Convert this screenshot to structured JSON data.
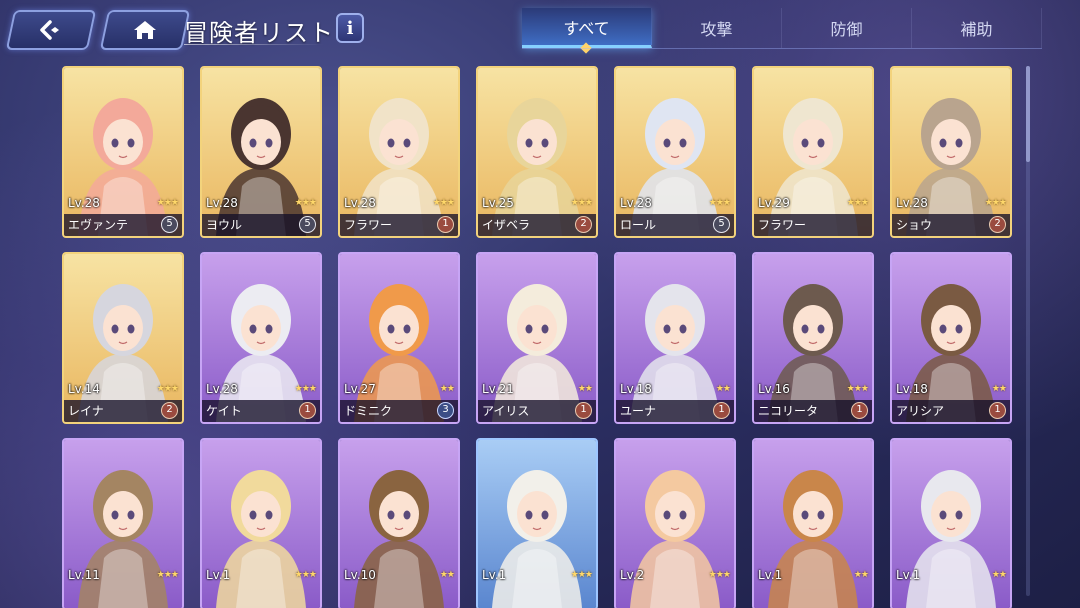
{
  "header": {
    "title": "冒険者リスト",
    "info_label": "i",
    "back_icon": "back-arrow-icon",
    "home_icon": "home-icon"
  },
  "tabs": [
    {
      "label": "すべて",
      "active": true
    },
    {
      "label": "攻撃",
      "active": false
    },
    {
      "label": "防御",
      "active": false
    },
    {
      "label": "補助",
      "active": false
    }
  ],
  "colors": {
    "gold_frame": "#f3d37c",
    "purple_frame": "#c7a5f5",
    "active_tab": "#3f6dc4"
  },
  "cards": [
    {
      "level": "Lv.28",
      "name": "エヴァンテ",
      "badge": "5",
      "stars": "★★★",
      "frame": "gold"
    },
    {
      "level": "Lv.28",
      "name": "ヨウル",
      "badge": "5",
      "stars": "★★★",
      "frame": "gold"
    },
    {
      "level": "Lv.28",
      "name": "フラワー",
      "badge": "1",
      "stars": "★★★",
      "frame": "gold"
    },
    {
      "level": "Lv.25",
      "name": "イザベラ",
      "badge": "2",
      "stars": "★★★",
      "frame": "gold"
    },
    {
      "level": "Lv.28",
      "name": "ロール",
      "badge": "5",
      "stars": "★★★",
      "frame": "gold"
    },
    {
      "level": "Lv.29",
      "name": "フラワー",
      "badge": "",
      "stars": "★★★",
      "frame": "gold"
    },
    {
      "level": "Lv.28",
      "name": "ショウ",
      "badge": "2",
      "stars": "★★★",
      "frame": "gold"
    },
    {
      "level": "Lv.14",
      "name": "レイナ",
      "badge": "2",
      "stars": "★★★",
      "frame": "gold"
    },
    {
      "level": "Lv.28",
      "name": "ケイト",
      "badge": "1",
      "stars": "★★★",
      "frame": "purple"
    },
    {
      "level": "Lv.27",
      "name": "ドミニク",
      "badge": "3",
      "stars": "★★",
      "frame": "purple"
    },
    {
      "level": "Lv.21",
      "name": "アイリス",
      "badge": "1",
      "stars": "★★",
      "frame": "purple"
    },
    {
      "level": "Lv.18",
      "name": "ユーナ",
      "badge": "1",
      "stars": "★★",
      "frame": "purple"
    },
    {
      "level": "Lv.16",
      "name": "ニコリータ",
      "badge": "1",
      "stars": "★★★",
      "frame": "purple"
    },
    {
      "level": "Lv.18",
      "name": "アリシア",
      "badge": "1",
      "stars": "★★",
      "frame": "purple"
    },
    {
      "level": "Lv.11",
      "name": "",
      "badge": "",
      "stars": "★★★",
      "frame": "purple"
    },
    {
      "level": "Lv.1",
      "name": "",
      "badge": "",
      "stars": "★★★",
      "frame": "purple"
    },
    {
      "level": "Lv.10",
      "name": "",
      "badge": "",
      "stars": "★★",
      "frame": "purple"
    },
    {
      "level": "Lv.1",
      "name": "",
      "badge": "",
      "stars": "★★★",
      "frame": "blue"
    },
    {
      "level": "Lv.2",
      "name": "",
      "badge": "",
      "stars": "★★★",
      "frame": "purple"
    },
    {
      "level": "Lv.1",
      "name": "",
      "badge": "",
      "stars": "★★",
      "frame": "purple"
    },
    {
      "level": "Lv.1",
      "name": "",
      "badge": "",
      "stars": "★★",
      "frame": "purple"
    }
  ]
}
